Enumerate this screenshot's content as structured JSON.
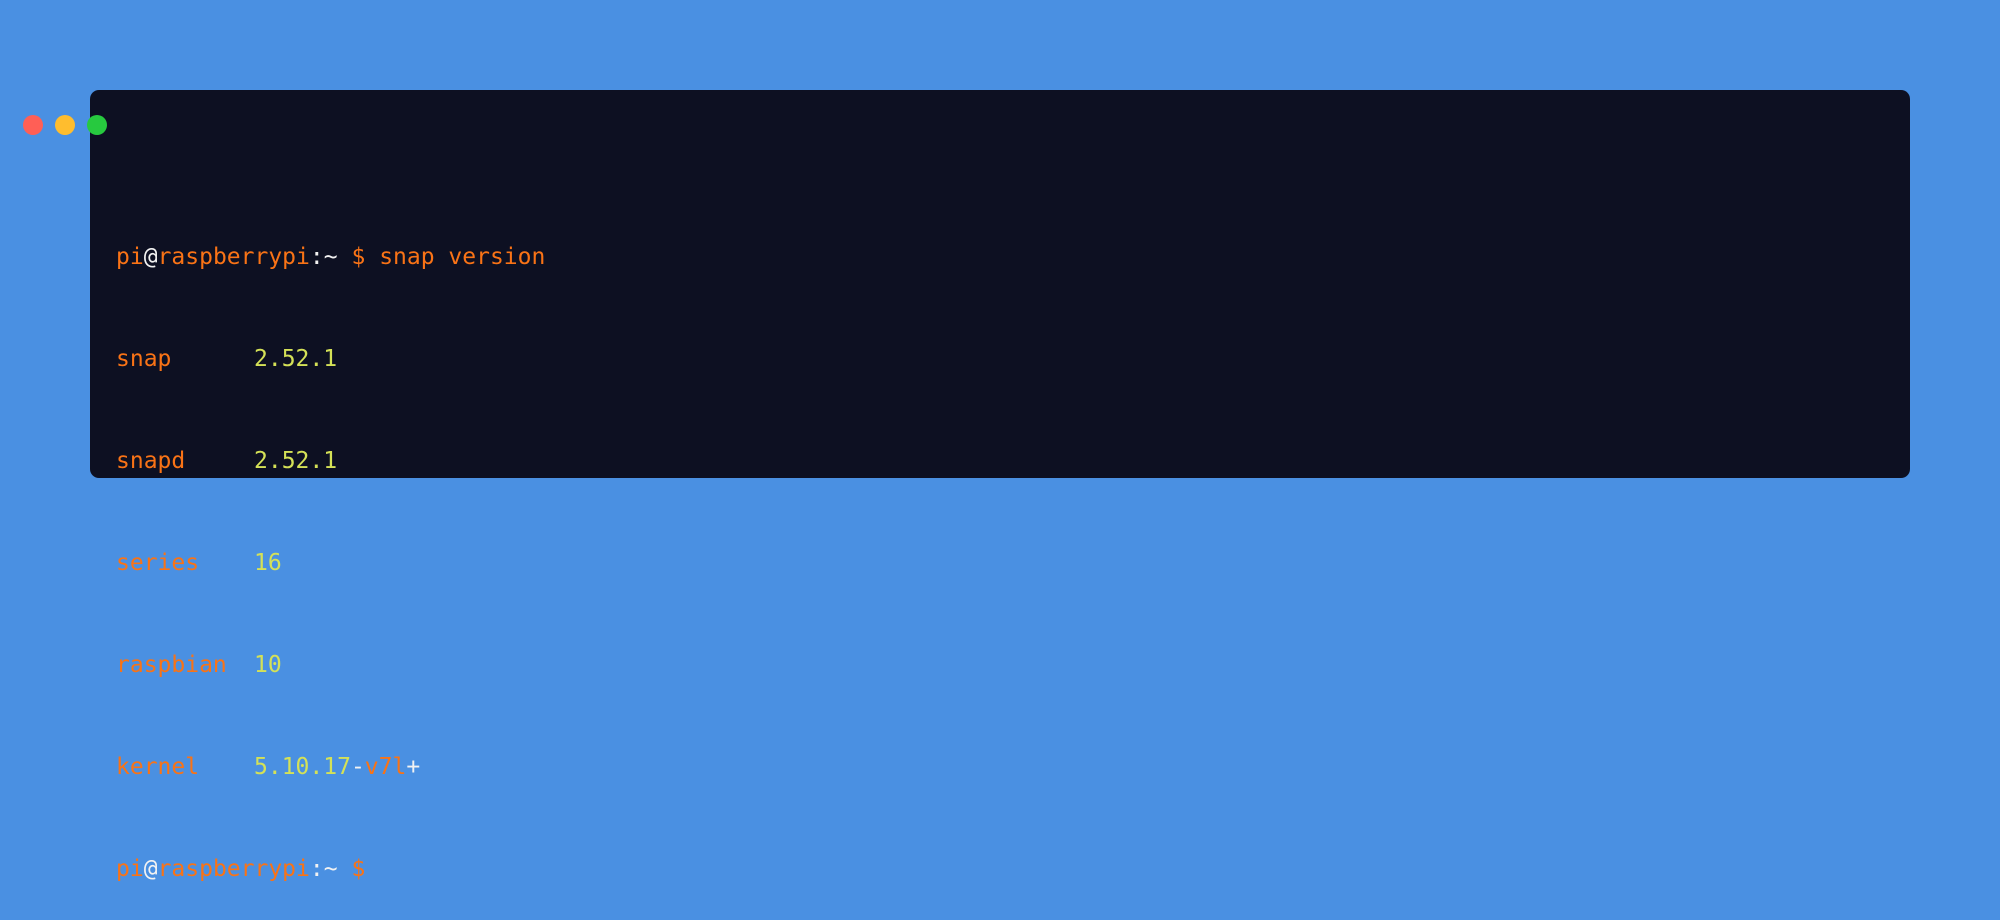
{
  "window": {
    "controls": [
      "close",
      "minimize",
      "maximize"
    ],
    "colors": {
      "close": "#ff5f56",
      "minimize": "#ffbd2e",
      "maximize": "#27c93f"
    }
  },
  "terminal": {
    "prompt": {
      "user": "pi",
      "at": "@",
      "host": "raspberrypi",
      "colon": ":",
      "path": "~",
      "symbol": "$"
    },
    "command": "snap version",
    "output": [
      {
        "key": "snap",
        "value": "2.52.1"
      },
      {
        "key": "snapd",
        "value": "2.52.1"
      },
      {
        "key": "series",
        "value": "16"
      },
      {
        "key": "raspbian",
        "value": "10"
      }
    ],
    "kernel": {
      "key": "kernel",
      "version": "5.10.17",
      "dash": "-",
      "arch": "v7l",
      "plus": "+"
    }
  },
  "colors": {
    "background": "#4a90e2",
    "terminal_bg": "#0d1022",
    "accent_orange": "#f97316",
    "value_yellow": "#d4e157",
    "text_white": "#f2f2f2"
  }
}
